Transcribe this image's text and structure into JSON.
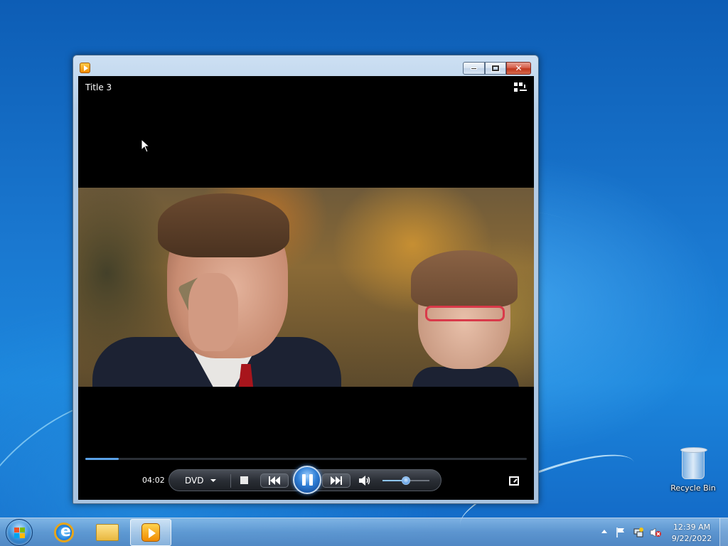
{
  "window": {
    "app_icon": "windows-media-player-icon",
    "controls": [
      "minimize",
      "maximize",
      "close"
    ]
  },
  "player": {
    "media_title": "Title 3",
    "elapsed_time": "04:02",
    "source_label": "DVD",
    "seek_progress": 0.075,
    "volume_level": 0.5,
    "state": "playing"
  },
  "desktop": {
    "icons": [
      {
        "label": "Recycle Bin",
        "icon": "recycle-bin-icon"
      }
    ]
  },
  "taskbar": {
    "pinned": [
      {
        "name": "Internet Explorer",
        "icon": "internet-explorer-icon"
      },
      {
        "name": "Windows Explorer",
        "icon": "folder-icon"
      },
      {
        "name": "Windows Media Player",
        "icon": "windows-media-player-icon",
        "active": true
      }
    ],
    "tray_icons": [
      "show-hidden-icons-arrow",
      "action-center-flag-icon",
      "network-icon",
      "volume-muted-icon"
    ],
    "clock": {
      "time": "12:39 AM",
      "date": "9/22/2022"
    }
  },
  "colors": {
    "desktop_blue": "#1a78d0",
    "accent_blue": "#2f7fd6",
    "close_red": "#c0391f"
  }
}
